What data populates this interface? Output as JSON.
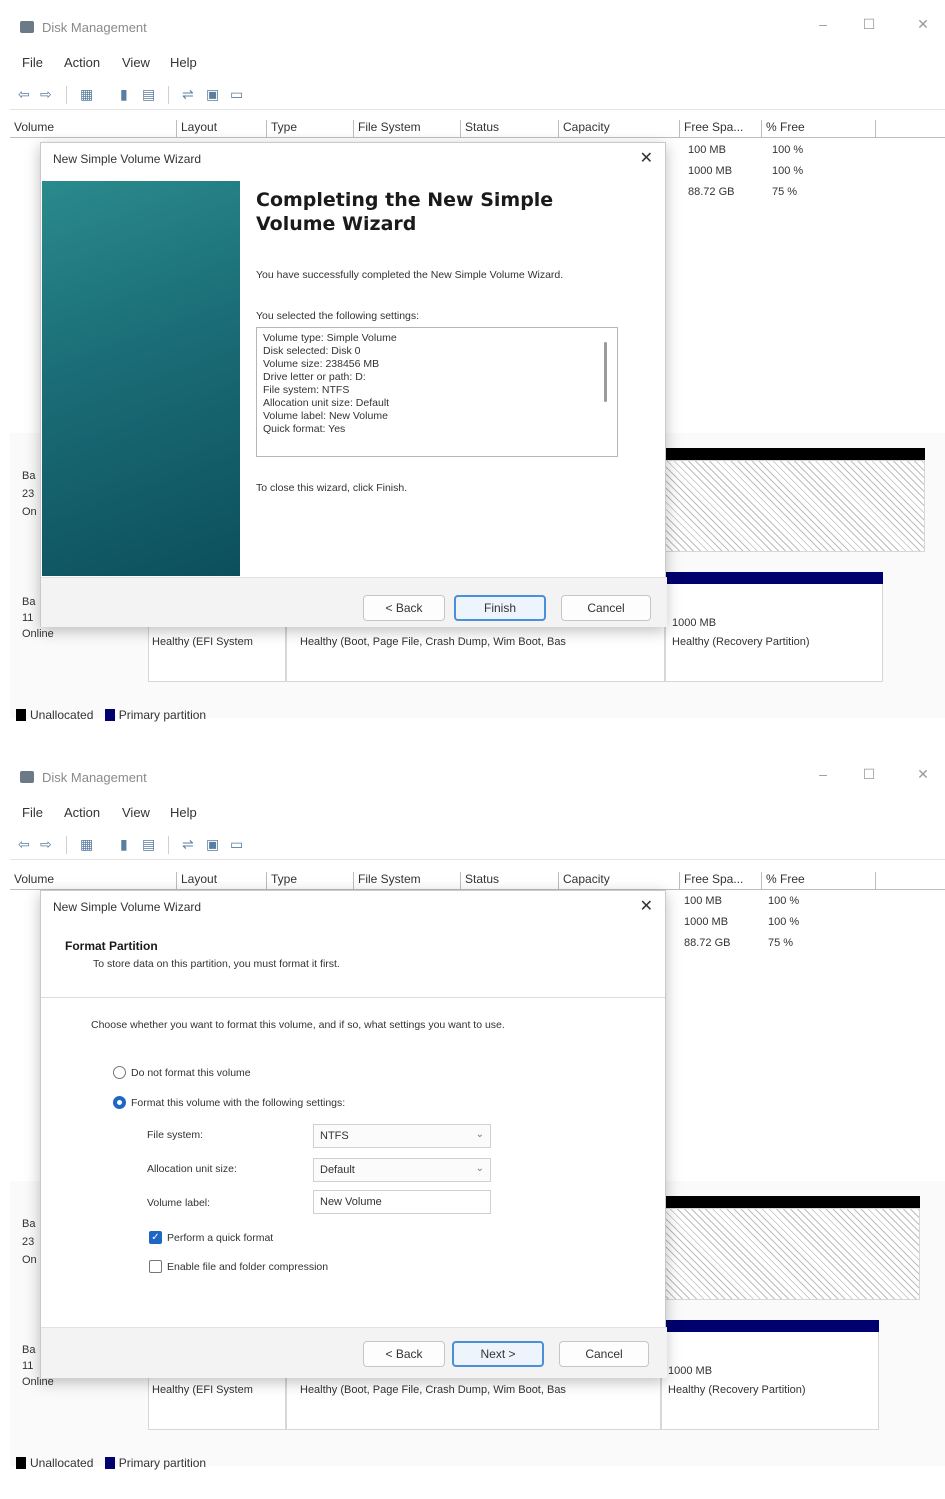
{
  "app": {
    "title": "Disk Management",
    "menu": [
      "File",
      "Action",
      "View",
      "Help"
    ],
    "window_controls": {
      "minimize": "–",
      "maximize": "☐",
      "close": "✕"
    }
  },
  "volume_columns": [
    "Volume",
    "Layout",
    "Type",
    "File System",
    "Status",
    "Capacity",
    "Free Spa...",
    "% Free"
  ],
  "free_space_rows": [
    {
      "free": "100 MB",
      "pct": "100 %"
    },
    {
      "free": "1000 MB",
      "pct": "100 %"
    },
    {
      "free": "88.72 GB",
      "pct": "75 %"
    }
  ],
  "disk_panel": {
    "disk0_labels": [
      "Ba",
      "23",
      "On"
    ],
    "disk1_labels": [
      "Ba",
      "11",
      "Online"
    ],
    "partitions": {
      "efi": "Healthy (EFI System",
      "main": "Healthy (Boot, Page File, Crash Dump, Wim Boot, Bas",
      "recovery_size": "1000 MB",
      "recovery_status": "Healthy (Recovery Partition)"
    }
  },
  "legend": {
    "unallocated": "Unallocated",
    "primary": "Primary partition"
  },
  "colors": {
    "primary": "#00006e",
    "unallocated": "#000000",
    "accent": "#1f67c5",
    "wizard_side": "#1a6c76"
  },
  "wizard1": {
    "title": "New Simple Volume Wizard",
    "heading": "Completing the New Simple Volume Wizard",
    "success_text": "You have successfully completed the New Simple Volume Wizard.",
    "settings_intro": "You selected the following settings:",
    "settings": [
      "Volume type: Simple Volume",
      "Disk selected: Disk 0",
      "Volume size: 238456 MB",
      "Drive letter or path: D:",
      "File system: NTFS",
      "Allocation unit size: Default",
      "Volume label: New Volume",
      "Quick format: Yes"
    ],
    "close_text": "To close this wizard, click Finish.",
    "buttons": {
      "back": "< Back",
      "finish": "Finish",
      "cancel": "Cancel"
    }
  },
  "wizard2": {
    "title": "New Simple Volume Wizard",
    "section_title": "Format Partition",
    "section_sub": "To store data on this partition, you must format it first.",
    "prompt": "Choose whether you want to format this volume, and if so, what settings you want to use.",
    "option_no": "Do not format this volume",
    "option_yes": "Format this volume with the following settings:",
    "file_system_label": "File system:",
    "file_system_value": "NTFS",
    "alloc_label": "Allocation unit size:",
    "alloc_value": "Default",
    "volume_label_label": "Volume label:",
    "volume_label_value": "New Volume",
    "quick_format": "Perform a quick format",
    "compression": "Enable file and folder compression",
    "buttons": {
      "back": "< Back",
      "next": "Next >",
      "cancel": "Cancel"
    }
  }
}
